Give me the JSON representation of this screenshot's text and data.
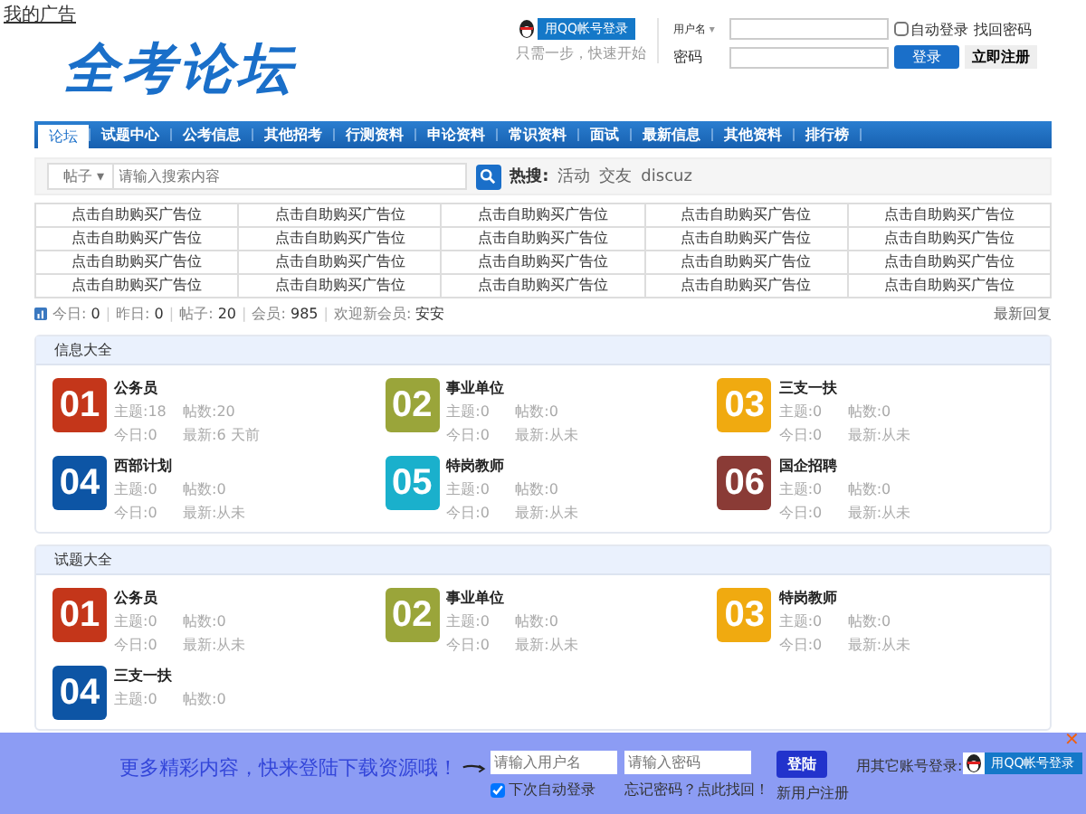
{
  "top_link": "我的广告",
  "logo": "全考论坛",
  "qq_login": {
    "button": "用QQ帐号登录",
    "hint": "只需一步，快速开始"
  },
  "login": {
    "username_label": "用户名",
    "username_caret": "▾",
    "auto_login": {
      "label": "自动登录",
      "checked": false
    },
    "forgot": "找回密码",
    "password_label": "密码",
    "submit": "登录",
    "register": "立即注册"
  },
  "nav": [
    {
      "label": "论坛",
      "selected": true
    },
    {
      "label": "试题中心",
      "selected": false
    },
    {
      "label": "公考信息",
      "selected": false
    },
    {
      "label": "其他招考",
      "selected": false
    },
    {
      "label": "行测资料",
      "selected": false
    },
    {
      "label": "申论资料",
      "selected": false
    },
    {
      "label": "常识资料",
      "selected": false
    },
    {
      "label": "面试",
      "selected": false
    },
    {
      "label": "最新信息",
      "selected": false
    },
    {
      "label": "其他资料",
      "selected": false
    },
    {
      "label": "排行榜",
      "selected": false
    }
  ],
  "search": {
    "scope": "帖子",
    "scope_caret": "▾",
    "placeholder": "请输入搜索内容",
    "hot_label": "热搜:",
    "hot": [
      "活动",
      "交友",
      "discuz"
    ]
  },
  "ads": [
    [
      "点击自助购买广告位",
      "点击自助购买广告位",
      "点击自助购买广告位",
      "点击自助购买广告位",
      "点击自助购买广告位"
    ],
    [
      "点击自助购买广告位",
      "点击自助购买广告位",
      "点击自助购买广告位",
      "点击自助购买广告位",
      "点击自助购买广告位"
    ],
    [
      "点击自助购买广告位",
      "点击自助购买广告位",
      "点击自助购买广告位",
      "点击自助购买广告位",
      "点击自助购买广告位"
    ],
    [
      "点击自助购买广告位",
      "点击自助购买广告位",
      "点击自助购买广告位",
      "点击自助购买广告位",
      "点击自助购买广告位"
    ]
  ],
  "stats": {
    "separator": "|",
    "items": [
      {
        "label": "今日:",
        "value": "0"
      },
      {
        "label": "昨日:",
        "value": "0"
      },
      {
        "label": "帖子:",
        "value": "20"
      },
      {
        "label": "会员:",
        "value": "985"
      },
      {
        "label": "欢迎新会员:",
        "value": "安安"
      }
    ],
    "latest": "最新回复"
  },
  "sections": [
    {
      "title": "信息大全",
      "forums": [
        {
          "num": "01",
          "color": "#c4361a",
          "name": "公务员",
          "topics": "主题:18",
          "posts": "帖数:20",
          "today": "今日:0",
          "latest": "最新:6 天前"
        },
        {
          "num": "02",
          "color": "#9aa53a",
          "name": "事业单位",
          "topics": "主题:0",
          "posts": "帖数:0",
          "today": "今日:0",
          "latest": "最新:从未"
        },
        {
          "num": "03",
          "color": "#f0aa10",
          "name": "三支一扶",
          "topics": "主题:0",
          "posts": "帖数:0",
          "today": "今日:0",
          "latest": "最新:从未"
        },
        {
          "num": "04",
          "color": "#0d55a5",
          "name": "西部计划",
          "topics": "主题:0",
          "posts": "帖数:0",
          "today": "今日:0",
          "latest": "最新:从未"
        },
        {
          "num": "05",
          "color": "#1ab0cc",
          "name": "特岗教师",
          "topics": "主题:0",
          "posts": "帖数:0",
          "today": "今日:0",
          "latest": "最新:从未"
        },
        {
          "num": "06",
          "color": "#8a3b36",
          "name": "国企招聘",
          "topics": "主题:0",
          "posts": "帖数:0",
          "today": "今日:0",
          "latest": "最新:从未"
        }
      ]
    },
    {
      "title": "试题大全",
      "forums": [
        {
          "num": "01",
          "color": "#c4361a",
          "name": "公务员",
          "topics": "主题:0",
          "posts": "帖数:0",
          "today": "今日:0",
          "latest": "最新:从未"
        },
        {
          "num": "02",
          "color": "#9aa53a",
          "name": "事业单位",
          "topics": "主题:0",
          "posts": "帖数:0",
          "today": "今日:0",
          "latest": "最新:从未"
        },
        {
          "num": "03",
          "color": "#f0aa10",
          "name": "特岗教师",
          "topics": "主题:0",
          "posts": "帖数:0",
          "today": "今日:0",
          "latest": "最新:从未"
        },
        {
          "num": "04",
          "color": "#0d55a5",
          "name": "三支一扶",
          "topics": "主题:0",
          "posts": "帖数:0"
        }
      ]
    }
  ],
  "bottom_bar": {
    "slogan": "更多精彩内容，快来登陆下载资源哦！",
    "username_placeholder": "请输入用户名",
    "password_placeholder": "请输入密码",
    "submit": "登陆",
    "remember": {
      "label": "下次自动登录",
      "checked": true
    },
    "forgot": "忘记密码？点此找回！",
    "register": "新用户注册",
    "other_label": "用其它账号登录:",
    "qq_button": "用QQ帐号登录",
    "close": "✕"
  }
}
